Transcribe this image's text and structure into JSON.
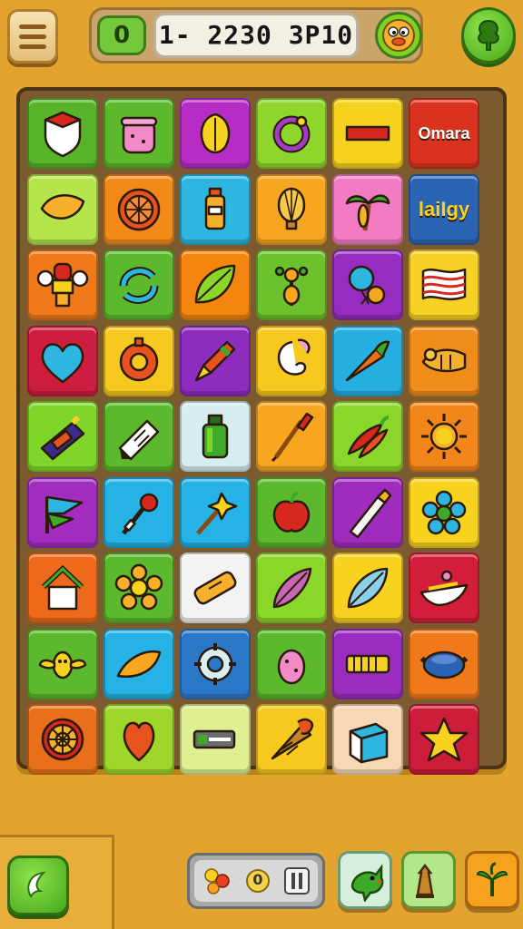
{
  "hud": {
    "move_counter": "0",
    "score_display": "1- 2230 3P10",
    "menu_icon": "hamburger-icon",
    "avatar_icon": "duck-face-icon",
    "tree_icon": "tree-icon"
  },
  "board": {
    "rows": 9,
    "cols": 6,
    "tiles": [
      {
        "bg": "#57B42A",
        "icon": "shield"
      },
      {
        "bg": "#5DB82C",
        "icon": "pot"
      },
      {
        "bg": "#B72CC4",
        "icon": "lemon"
      },
      {
        "bg": "#8ED62C",
        "icon": "ring"
      },
      {
        "bg": "#F6D21E",
        "icon": "bar"
      },
      {
        "bg": "#D9321E",
        "word": "Omara"
      },
      {
        "bg": "#B4E54A",
        "icon": "leaf"
      },
      {
        "bg": "#F28A1A",
        "icon": "citrus"
      },
      {
        "bg": "#2EB6E0",
        "icon": "bottle"
      },
      {
        "bg": "#F7A620",
        "icon": "balloon"
      },
      {
        "bg": "#F27BC4",
        "icon": "palm"
      },
      {
        "bg": "#2C64B4",
        "word": "laiIgy"
      },
      {
        "bg": "#F07A1A",
        "icon": "robot"
      },
      {
        "bg": "#5CB82C",
        "icon": "cycle"
      },
      {
        "bg": "#F4860F",
        "icon": "leaf2"
      },
      {
        "bg": "#6CC22C",
        "icon": "sprout"
      },
      {
        "bg": "#962CC0",
        "icon": "balloon2"
      },
      {
        "bg": "#F7D224",
        "icon": "flag"
      },
      {
        "bg": "#CE1E3E",
        "icon": "heart"
      },
      {
        "bg": "#F7C81E",
        "icon": "donut"
      },
      {
        "bg": "#8E2CC0",
        "icon": "crayon"
      },
      {
        "bg": "#F7C81E",
        "icon": "swirl"
      },
      {
        "bg": "#26AEE0",
        "icon": "carrot"
      },
      {
        "bg": "#F08C1A",
        "icon": "horn"
      },
      {
        "bg": "#7ED62A",
        "icon": "marker"
      },
      {
        "bg": "#5CB82C",
        "icon": "tube"
      },
      {
        "bg": "#D6EEF0",
        "icon": "bottle2"
      },
      {
        "bg": "#F7A620",
        "icon": "brush"
      },
      {
        "bg": "#8AD62A",
        "icon": "pepper"
      },
      {
        "bg": "#F2861A",
        "icon": "sun"
      },
      {
        "bg": "#A22CC0",
        "icon": "pennant"
      },
      {
        "bg": "#26B2E4",
        "icon": "spray"
      },
      {
        "bg": "#26B2E4",
        "icon": "wand"
      },
      {
        "bg": "#5CB82C",
        "icon": "apple"
      },
      {
        "bg": "#A02CBE",
        "icon": "pen"
      },
      {
        "bg": "#F7D21E",
        "icon": "flower"
      },
      {
        "bg": "#EE6A1A",
        "icon": "house"
      },
      {
        "bg": "#5CB82C",
        "icon": "flower2"
      },
      {
        "bg": "#F3F3F3",
        "icon": "bandage"
      },
      {
        "bg": "#8AD62A",
        "icon": "feather"
      },
      {
        "bg": "#F7D21E",
        "icon": "leaf3"
      },
      {
        "bg": "#D21E3A",
        "icon": "bowl"
      },
      {
        "bg": "#5CB82C",
        "icon": "wings"
      },
      {
        "bg": "#26B2E4",
        "icon": "mango"
      },
      {
        "bg": "#2C78C8",
        "icon": "gear"
      },
      {
        "bg": "#5CB82C",
        "icon": "berry"
      },
      {
        "bg": "#9A2CC0",
        "icon": "key"
      },
      {
        "bg": "#F07A1A",
        "icon": "dish"
      },
      {
        "bg": "#E8701A",
        "icon": "wheel"
      },
      {
        "bg": "#9ED62A",
        "icon": "heart2"
      },
      {
        "bg": "#DEF092",
        "icon": "battery"
      },
      {
        "bg": "#F7C81E",
        "icon": "cone"
      },
      {
        "bg": "#F8D8B4",
        "icon": "box"
      },
      {
        "bg": "#CC1E3A",
        "icon": "star"
      }
    ]
  },
  "bottom": {
    "inventory_count": "0",
    "leaf_icon": "leaf-button-icon",
    "powerups": [
      {
        "name": "bird-icon",
        "bg": "#D6EEDC",
        "border": "#6C9C78"
      },
      {
        "name": "tower-icon",
        "bg": "#B4E68A",
        "border": "#5E9430"
      },
      {
        "name": "plant-icon",
        "bg": "#F7A21E",
        "border": "#A8620C"
      }
    ]
  }
}
